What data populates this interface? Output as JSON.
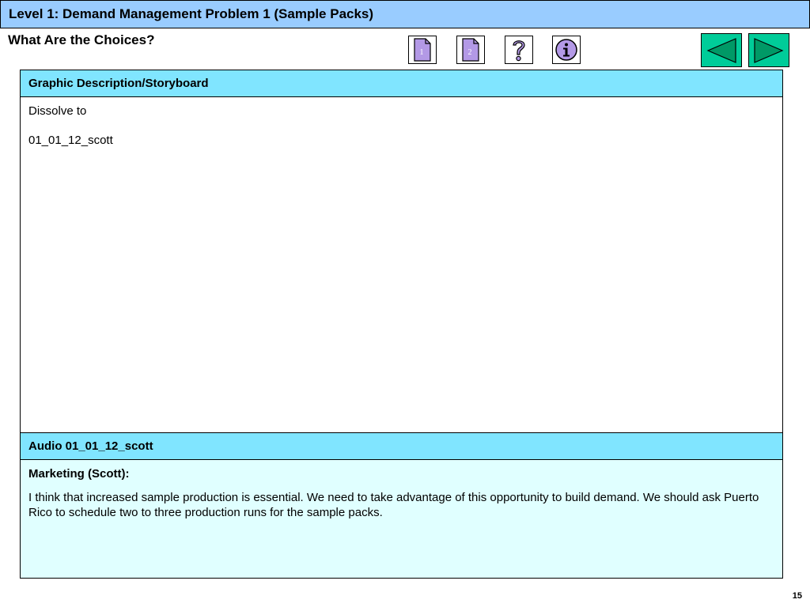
{
  "header": {
    "title": "Level 1: Demand Management Problem 1 (Sample Packs)",
    "subtitle": "What Are the Choices?"
  },
  "toolbar": {
    "doc1_label": "1",
    "doc2_label": "2",
    "help_icon": "question-mark-icon",
    "info_icon": "info-icon",
    "back_icon": "left-arrow-icon",
    "forward_icon": "right-arrow-icon"
  },
  "storyboard": {
    "header": "Graphic Description/Storyboard",
    "line1": "Dissolve to",
    "line2": "01_01_12_scott"
  },
  "audio": {
    "header": "Audio 01_01_12_scott",
    "speaker": "Marketing (Scott):",
    "text": "I think that increased sample production is essential. We need to take advantage of this opportunity to build demand. We should ask Puerto Rico to schedule two to three production runs for the sample packs."
  },
  "footer": {
    "page_number": "15"
  },
  "colors": {
    "title_bar": "#99ccff",
    "panel_header": "#80e5ff",
    "audio_body": "#e0ffff",
    "nav_icon_fill": "#b399e6",
    "arrow_bg": "#00cc99",
    "arrow_fill": "#009966"
  }
}
